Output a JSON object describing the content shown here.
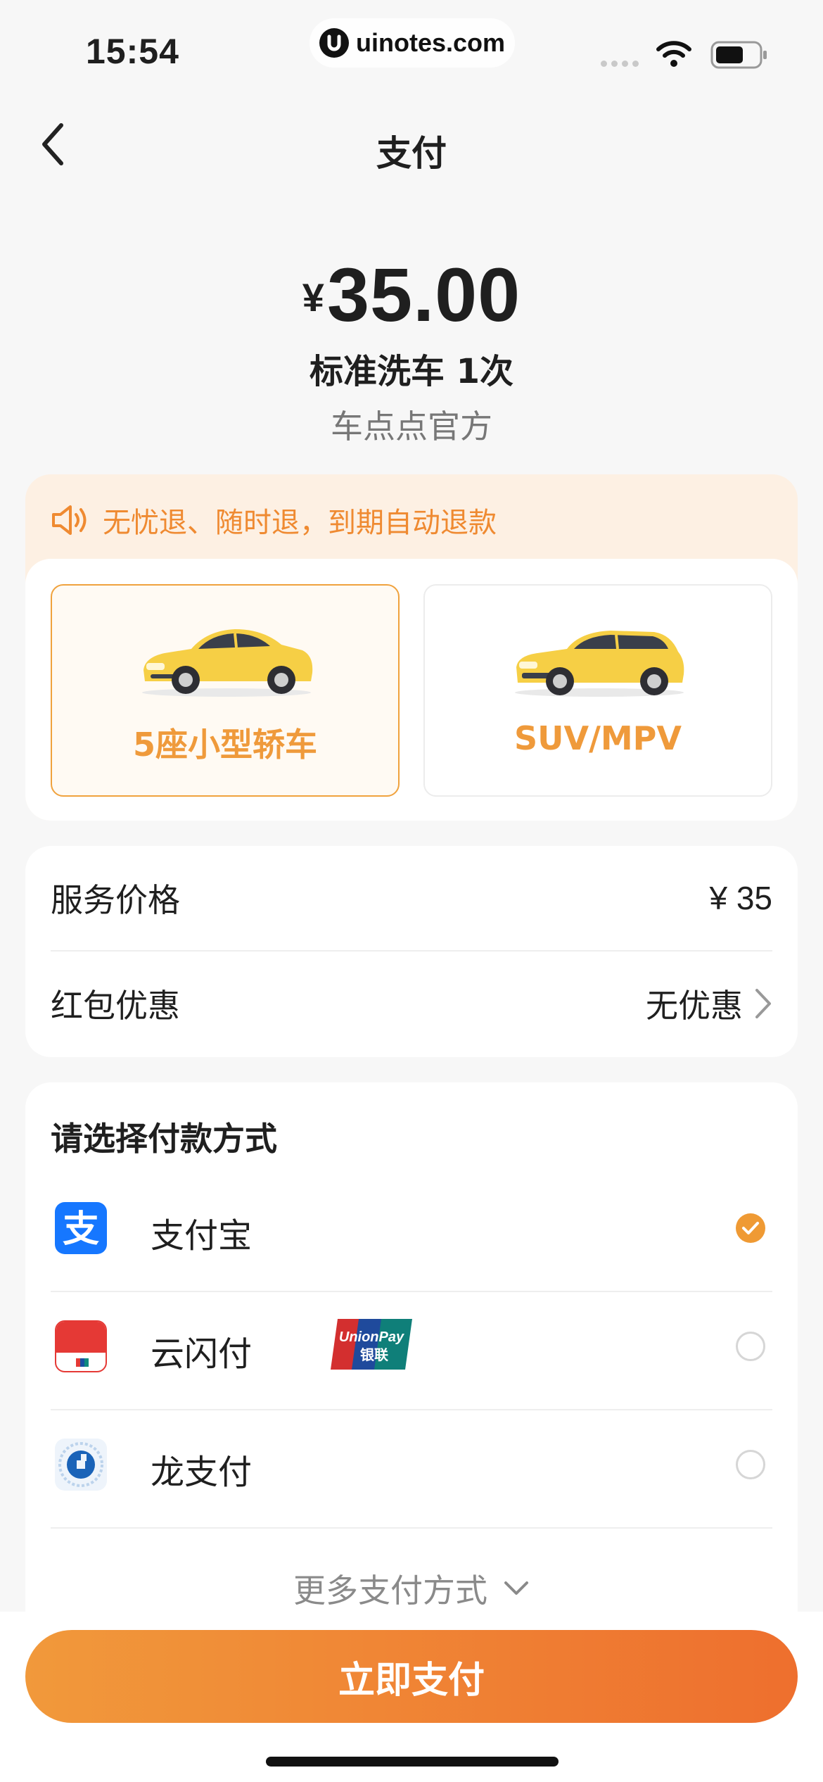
{
  "status_bar": {
    "time": "15:54",
    "watermark": "uinotes.com",
    "icons": [
      "signal-icon",
      "wifi-icon",
      "battery-icon"
    ]
  },
  "nav": {
    "title": "支付",
    "back_icon": "chevron-left-icon"
  },
  "order": {
    "currency_symbol": "¥",
    "amount": "35.00",
    "product": "标准洗车 1次",
    "merchant": "车点点官方"
  },
  "notice": {
    "icon": "speaker-icon",
    "text": "无忧退、随时退，到期自动退款"
  },
  "car_types": [
    {
      "label": "5座小型轿车",
      "selected": true,
      "icon": "sedan-car-icon"
    },
    {
      "label": "SUV/MPV",
      "selected": false,
      "icon": "suv-car-icon"
    }
  ],
  "pricing": {
    "service_price_label": "服务价格",
    "service_price_value": "¥ 35",
    "discount_label": "红包优惠",
    "discount_value": "无优惠"
  },
  "payment": {
    "title": "请选择付款方式",
    "methods": [
      {
        "label": "支付宝",
        "icon": "alipay-icon",
        "selected": true
      },
      {
        "label": "云闪付",
        "icon": "quickpass-icon",
        "badge": "unionpay-icon",
        "badge_text": "UnionPay",
        "badge_subtext": "银联",
        "selected": false
      },
      {
        "label": "龙支付",
        "icon": "ccb-pay-icon",
        "selected": false
      }
    ],
    "more_label": "更多支付方式"
  },
  "action": {
    "pay_button": "立即支付"
  },
  "colors": {
    "accent": "#ef9a34",
    "button_start": "#f1993b",
    "button_end": "#ee6f2e",
    "notice_bg": "#fdf0e3",
    "page_bg": "#f7f7f7"
  }
}
